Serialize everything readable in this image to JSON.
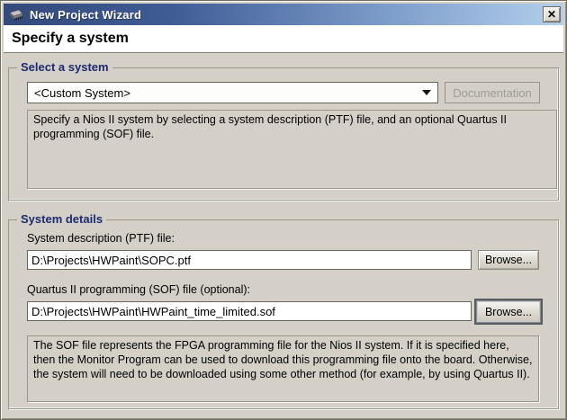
{
  "window": {
    "title": "New Project Wizard",
    "close_glyph": "✕",
    "heading": "Specify a system"
  },
  "select_system": {
    "group_label": "Select a system",
    "combo_value": "<Custom System>",
    "documentation_button": "Documentation",
    "description": "Specify a Nios II system by selecting a system description (PTF) file, and an optional Quartus II programming (SOF) file."
  },
  "system_details": {
    "group_label": "System details",
    "ptf_label": "System description (PTF) file:",
    "ptf_value": "D:\\Projects\\HWPaint\\SOPC.ptf",
    "ptf_browse_button": "Browse...",
    "sof_label": "Quartus II programming (SOF) file (optional):",
    "sof_value": "D:\\Projects\\HWPaint\\HWPaint_time_limited.sof",
    "sof_browse_button": "Browse...",
    "description": "The SOF file represents the FPGA programming file for the Nios II system. If it is specified here, then the Monitor Program can be used to download this programming file onto the board. Otherwise, the system will need to be downloaded using some other method (for example, by using Quartus II)."
  },
  "colors": {
    "dialog_bg": "#d4d0c8",
    "titlebar_gradient_start": "#33497b",
    "titlebar_gradient_end": "#b3cfec",
    "group_label_text": "#1e2a6e",
    "disabled_text": "#9e9c94"
  }
}
